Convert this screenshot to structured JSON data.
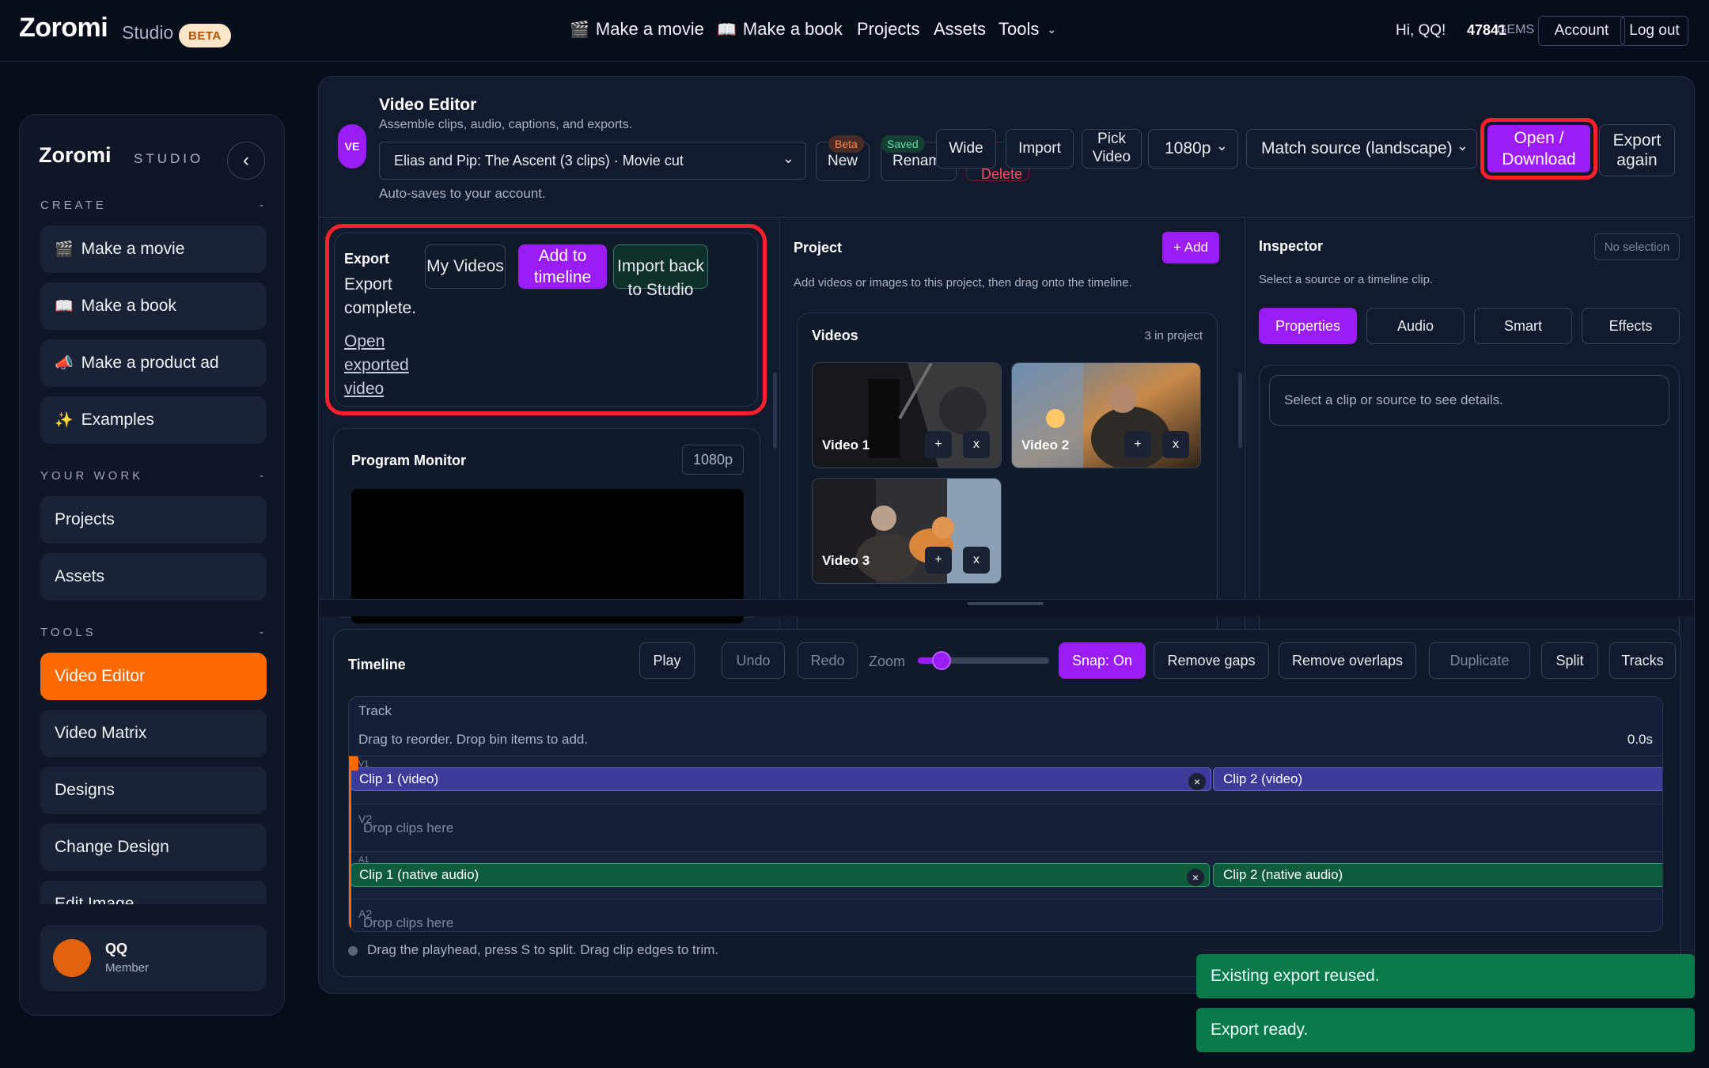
{
  "header": {
    "brand": "Zoromi",
    "brand_sub": "Studio",
    "beta": "BETA",
    "nav": [
      "Make a movie",
      "Make a book",
      "Projects",
      "Assets",
      "Tools"
    ],
    "greeting": "Hi, QQ!",
    "gems_count": "47841",
    "gems_label": "GEMS",
    "account": "Account",
    "logout": "Log out"
  },
  "sidebar": {
    "brand": "Zoromi",
    "brand_sub": "STUDIO",
    "create_label": "CREATE",
    "create_items": [
      "Make a movie",
      "Make a book",
      "Make a product ad",
      "Examples"
    ],
    "work_label": "YOUR WORK",
    "work_items": [
      "Projects",
      "Assets"
    ],
    "tools_label": "TOOLS",
    "tool_items": [
      "Video Editor",
      "Video Matrix",
      "Designs",
      "Change Design",
      "Edit Image"
    ],
    "collapse_dash": "-",
    "user_name": "QQ",
    "user_role": "Member"
  },
  "editor": {
    "badge": "VE",
    "title": "Video Editor",
    "subtitle": "Assemble clips, audio, captions, and exports.",
    "project_select": "Elias and Pip: The Ascent (3 clips) · Movie cut",
    "autosave": "Auto-saves to your account.",
    "beta_tag": "Beta",
    "saved_tag": "Saved",
    "btn_new": "New",
    "btn_rename": "Rename",
    "btn_delete": "Delete",
    "btn_wide": "Wide",
    "btn_import": "Import",
    "btn_pick": "Pick Video",
    "resolution": "1080p",
    "aspect": "Match source (landscape)",
    "btn_open": "Open / Download",
    "btn_export_again": "Export again"
  },
  "export_panel": {
    "title": "Export",
    "status": "Export complete.",
    "link": "Open exported video",
    "btn_my_videos": "My Videos",
    "btn_add_timeline": "Add to timeline",
    "btn_import_back": "Import back to Studio"
  },
  "monitor": {
    "title": "Program Monitor",
    "resolution": "1080p"
  },
  "project_panel": {
    "title": "Project",
    "add": "+ Add",
    "hint": "Add videos or images to this project, then drag onto the timeline.",
    "videos_title": "Videos",
    "count": "3 in project",
    "videos": [
      "Video 1",
      "Video 2",
      "Video 3"
    ],
    "plus": "+",
    "remove": "x"
  },
  "inspector": {
    "title": "Inspector",
    "no_selection": "No selection",
    "hint": "Select a source or a timeline clip.",
    "tabs": [
      "Properties",
      "Audio",
      "Smart",
      "Effects"
    ],
    "placeholder": "Select a clip or source to see details."
  },
  "timeline": {
    "title": "Timeline",
    "play": "Play",
    "undo": "Undo",
    "redo": "Redo",
    "zoom": "Zoom",
    "zoom_level": 0.18,
    "snap": "Snap: On",
    "remove_gaps": "Remove gaps",
    "remove_overlaps": "Remove overlaps",
    "duplicate": "Duplicate",
    "split": "Split",
    "tracks": "Tracks",
    "track_label": "Track",
    "drag_hint": "Drag to reorder. Drop bin items to add.",
    "time": "0.0s",
    "v1": "V1",
    "v2": "V2",
    "a1": "A1",
    "a2": "A2",
    "clip1_video": "Clip 1 (video)",
    "clip2_video": "Clip 2 (video)",
    "clip1_audio": "Clip 1 (native audio)",
    "clip2_audio": "Clip 2 (native audio)",
    "drop": "Drop clips here",
    "close": "×",
    "footer_hint": "Drag the playhead, press S to split. Drag clip edges to trim."
  },
  "toasts": [
    "Existing export reused.",
    "Export ready."
  ],
  "colors": {
    "accent_purple": "#9b1cf5",
    "accent_orange": "#ff6a00",
    "highlight_red": "#ff1f2d",
    "toast_green": "#0a7a4d"
  }
}
